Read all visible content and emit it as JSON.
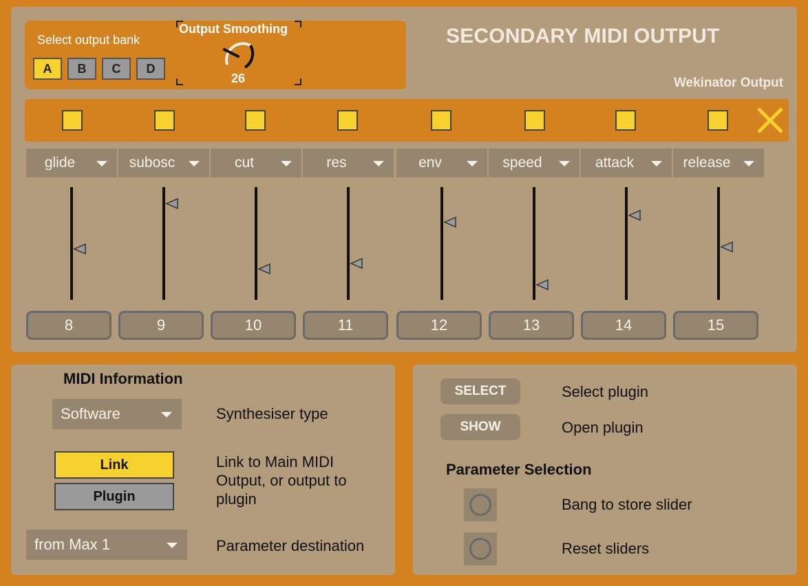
{
  "bank": {
    "title": "Select output bank",
    "buttons": [
      "A",
      "B",
      "C",
      "D"
    ],
    "selected": "A"
  },
  "smoothing": {
    "title": "Output Smoothing",
    "value": "26"
  },
  "header": {
    "title": "SECONDARY MIDI OUTPUT",
    "wekinator_label": "Wekinator Output"
  },
  "params": [
    {
      "name": "glide",
      "value": 0.46,
      "number": "8"
    },
    {
      "name": "subosc",
      "value": 0.92,
      "number": "9"
    },
    {
      "name": "cut",
      "value": 0.26,
      "number": "10"
    },
    {
      "name": "res",
      "value": 0.31,
      "number": "11"
    },
    {
      "name": "env",
      "value": 0.73,
      "number": "12"
    },
    {
      "name": "speed",
      "value": 0.1,
      "number": "13"
    },
    {
      "name": "attack",
      "value": 0.8,
      "number": "14"
    },
    {
      "name": "release",
      "value": 0.48,
      "number": "15"
    }
  ],
  "midi": {
    "title": "MIDI Information",
    "synth_type_value": "Software",
    "synth_type_label": "Synthesiser type",
    "link_label": "Link",
    "plugin_label": "Plugin",
    "link_desc_1": "Link to Main MIDI",
    "link_desc_2": "Output, or output to",
    "link_desc_3": "plugin",
    "destination_value": "from Max 1",
    "destination_label": "Parameter destination"
  },
  "plugin": {
    "select_btn": "SELECT",
    "select_label": "Select plugin",
    "show_btn": "SHOW",
    "show_label": "Open plugin",
    "param_title": "Parameter Selection",
    "bang_store_label": "Bang to store slider",
    "reset_label": "Reset sliders"
  },
  "colors": {
    "accent": "#d4821f",
    "panel": "#b39c7c",
    "highlight": "#f7d12e"
  }
}
